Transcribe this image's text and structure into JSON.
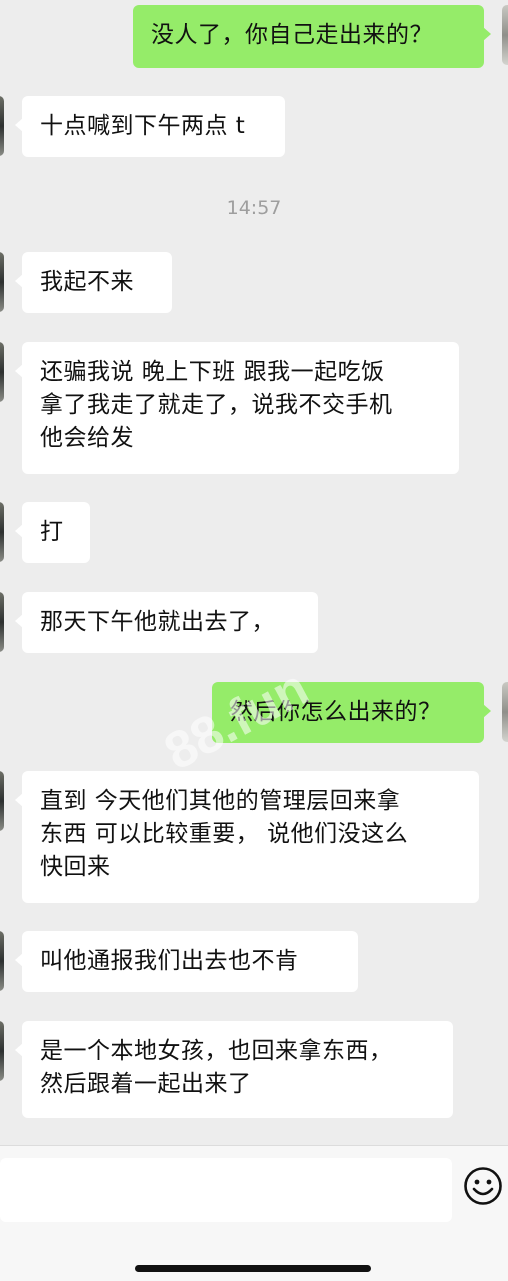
{
  "messages": [
    {
      "side": "right",
      "text": "没人了，你自己走出来的？"
    },
    {
      "side": "left",
      "text": "十点喊到下午两点 t"
    },
    {
      "side": "left",
      "text": "我起不来"
    },
    {
      "side": "left",
      "text": "还骗我说 晚上下班 跟我一起吃饭\n拿了我走了就走了，说我不交手机\n他会给发"
    },
    {
      "side": "left",
      "text": "打"
    },
    {
      "side": "left",
      "text": "那天下午他就出去了，"
    },
    {
      "side": "right",
      "text": "然后你怎么出来的？"
    },
    {
      "side": "left",
      "text": "直到 今天他们其他的管理层回来拿\n东西 可以比较重要， 说他们没这么\n快回来"
    },
    {
      "side": "left",
      "text": "叫他通报我们出去也不肯"
    },
    {
      "side": "left",
      "text": "是一个本地女孩，也回来拿东西，\n然后跟着一起出来了"
    }
  ],
  "timestamp": "14:57",
  "watermark": "88.fun",
  "input": {
    "value": "",
    "emoji_icon": "smiley-face-icon"
  },
  "colors": {
    "sent_bubble": "#95ec69",
    "received_bubble": "#ffffff",
    "background": "#ededed"
  }
}
